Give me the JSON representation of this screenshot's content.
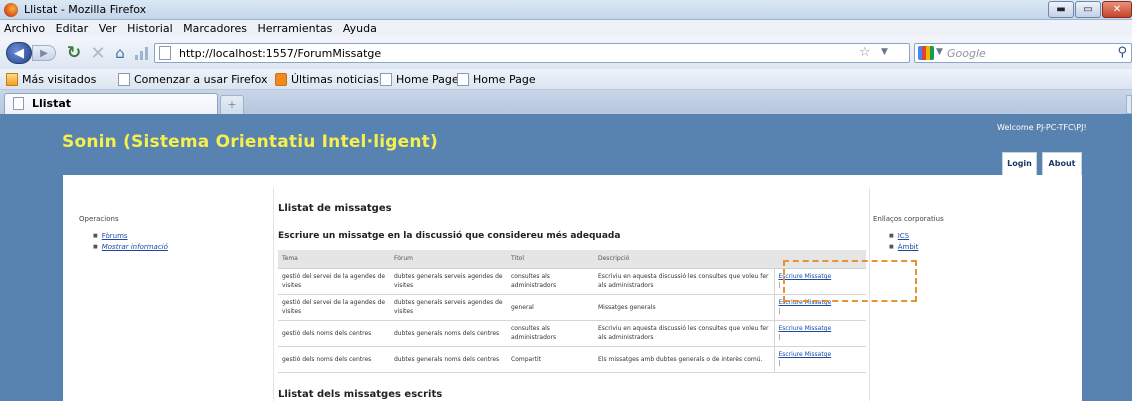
{
  "window": {
    "title": "Llistat - Mozilla Firefox",
    "buttons": {
      "minimize": "▬",
      "maximize": "▭",
      "close": "✕"
    }
  },
  "menu": [
    {
      "label": "Archivo"
    },
    {
      "label": "Editar"
    },
    {
      "label": "Ver"
    },
    {
      "label": "Historial"
    },
    {
      "label": "Marcadores"
    },
    {
      "label": "Herramientas"
    },
    {
      "label": "Ayuda"
    }
  ],
  "nav": {
    "url": "http://localhost:1557/ForumMissatge",
    "search_placeholder": "Google"
  },
  "bookmarks": [
    {
      "label": "Más visitados",
      "icon": "most-visited-icon"
    },
    {
      "label": "Comenzar a usar Firefox",
      "icon": "page-icon"
    },
    {
      "label": "Últimas noticias",
      "icon": "rss-icon"
    },
    {
      "label": "Home Page",
      "icon": "page-icon"
    },
    {
      "label": "Home Page",
      "icon": "page-icon"
    }
  ],
  "tabs": [
    {
      "label": "Llistat"
    }
  ],
  "site": {
    "title": "Sonin (Sistema Orientatiu Intel·ligent)",
    "welcome": "Welcome PJ-PC-TFC\\PJ!",
    "nav": {
      "login": "Login",
      "about": "About"
    }
  },
  "left": {
    "title": "Operacions",
    "links": [
      "Fòrums",
      "Mostrar informació"
    ]
  },
  "right": {
    "title": "Enllaços corporatius",
    "links": [
      "ICS",
      "Àmbit"
    ]
  },
  "center": {
    "heading": "Llistat de missatges",
    "subheading": "Escriure un missatge en la discussió que considereu més adequada",
    "bottom_heading": "Llistat dels missatges escrits",
    "table": {
      "headers": [
        "Tema",
        "Fòrum",
        "Títol",
        "Descripció",
        ""
      ],
      "rows": [
        {
          "tema": "gestió del servei de la agendes de visites",
          "forum": "dubtes generals serveis agendes de visites",
          "titol": "consultes als administradors",
          "descripcio": "Escriviu en aquesta discussió les consultes que voleu fer als administradors",
          "action": "Escriure Missatge",
          "pipe": "|"
        },
        {
          "tema": "gestió del servei de la agendes de visites",
          "forum": "dubtes generals serveis agendes de visites",
          "titol": "general",
          "descripcio": "Missatges generals",
          "action": "Escriure Missatge",
          "pipe": "|"
        },
        {
          "tema": "gestió dels noms dels centres",
          "forum": "dubtes generals noms dels centres",
          "titol": "consultes als administradors",
          "descripcio": "Escriviu en aquesta discussió les consultes que voleu fer als administradors",
          "action": "Escriure Missatge",
          "pipe": "|"
        },
        {
          "tema": "gestió dels noms dels centres",
          "forum": "dubtes generals noms dels centres",
          "titol": "Compartit",
          "descripcio": "Els missatges amb dubtes generals o de interès comú.",
          "action": "Escriure Missatge",
          "pipe": "|"
        }
      ]
    }
  },
  "colors": {
    "page_bg": "#5883b1",
    "site_title": "#f6f04f",
    "highlight": "#e59431",
    "link": "#1a4aa8"
  }
}
